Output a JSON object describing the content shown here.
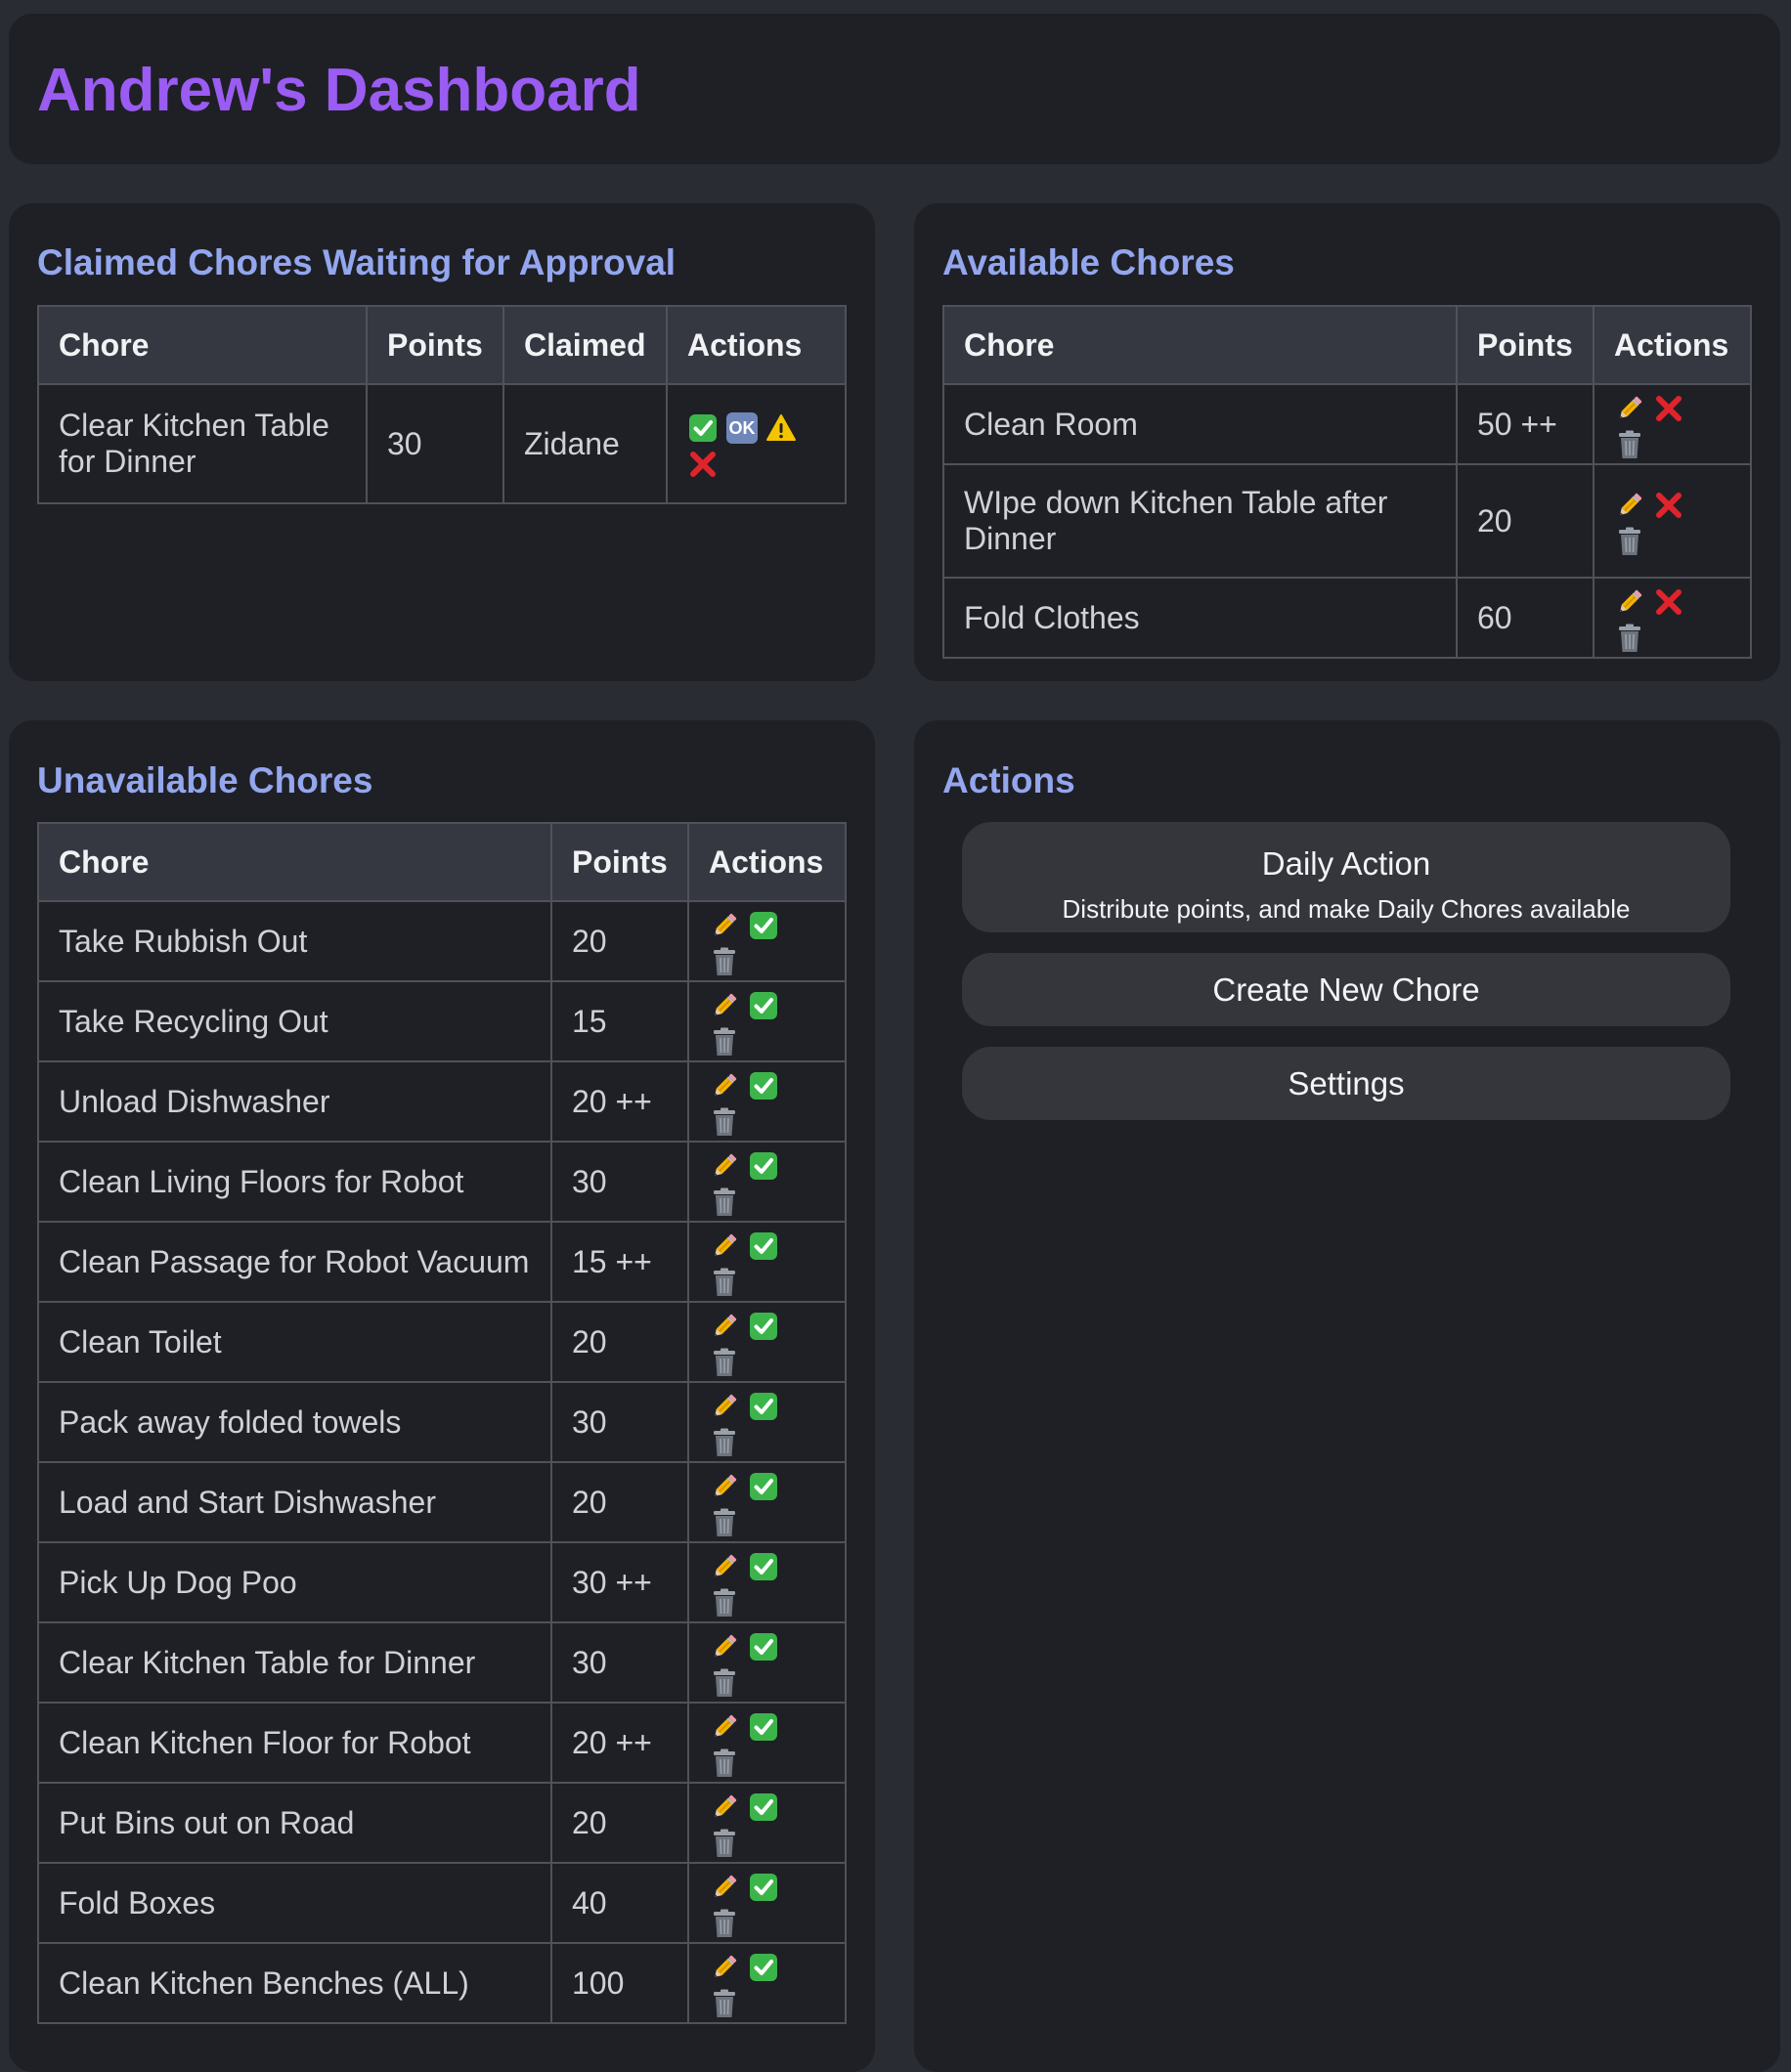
{
  "header": {
    "title": "Andrew's Dashboard"
  },
  "claimed": {
    "title": "Claimed Chores Waiting for Approval",
    "columns": [
      "Chore",
      "Points",
      "Claimed",
      "Actions"
    ],
    "rows": [
      {
        "chore": "Clear Kitchen Table for Dinner",
        "points": "30",
        "claimed_by": "Zidane",
        "actions": [
          "approve-icon",
          "ok-icon",
          "warning-icon",
          "reject-icon"
        ]
      }
    ],
    "ok_icon_text": "OK"
  },
  "available": {
    "title": "Available Chores",
    "columns": [
      "Chore",
      "Points",
      "Actions"
    ],
    "rows": [
      {
        "chore": "Clean Room",
        "points": "50 ++",
        "actions": [
          "edit-icon",
          "cross-icon",
          "trash-icon"
        ]
      },
      {
        "chore": "WIpe down Kitchen Table after Dinner",
        "points": "20",
        "actions": [
          "edit-icon",
          "cross-icon",
          "trash-icon"
        ]
      },
      {
        "chore": "Fold Clothes",
        "points": "60",
        "actions": [
          "edit-icon",
          "cross-icon",
          "trash-icon"
        ]
      }
    ]
  },
  "unavailable": {
    "title": "Unavailable Chores",
    "columns": [
      "Chore",
      "Points",
      "Actions"
    ],
    "row_actions": [
      "edit-icon",
      "check-icon",
      "trash-icon"
    ],
    "rows": [
      {
        "chore": "Take Rubbish Out",
        "points": "20"
      },
      {
        "chore": "Take Recycling Out",
        "points": "15"
      },
      {
        "chore": "Unload Dishwasher",
        "points": "20 ++"
      },
      {
        "chore": "Clean Living Floors for Robot",
        "points": "30"
      },
      {
        "chore": "Clean Passage for Robot Vacuum",
        "points": "15 ++"
      },
      {
        "chore": "Clean Toilet",
        "points": "20"
      },
      {
        "chore": "Pack away folded towels",
        "points": "30"
      },
      {
        "chore": "Load and Start Dishwasher",
        "points": "20"
      },
      {
        "chore": "Pick Up Dog Poo",
        "points": "30 ++"
      },
      {
        "chore": "Clear Kitchen Table for Dinner",
        "points": "30"
      },
      {
        "chore": "Clean Kitchen Floor for Robot",
        "points": "20 ++"
      },
      {
        "chore": "Put Bins out on Road",
        "points": "20"
      },
      {
        "chore": "Fold Boxes",
        "points": "40"
      },
      {
        "chore": "Clean Kitchen Benches (ALL)",
        "points": "100"
      }
    ]
  },
  "actions": {
    "title": "Actions",
    "daily": {
      "label": "Daily Action",
      "description": "Distribute points, and make Daily Chores available"
    },
    "create_label": "Create New Chore",
    "settings_label": "Settings"
  },
  "colors": {
    "background": "#2a2c33",
    "card": "#1f2025",
    "title_purple": "#9a5cf2",
    "section_blue": "#93a6ee",
    "button": "#34363c",
    "check_green": "#3bb54a",
    "cross_red": "#e0242b",
    "warning_yellow": "#f5c400"
  }
}
